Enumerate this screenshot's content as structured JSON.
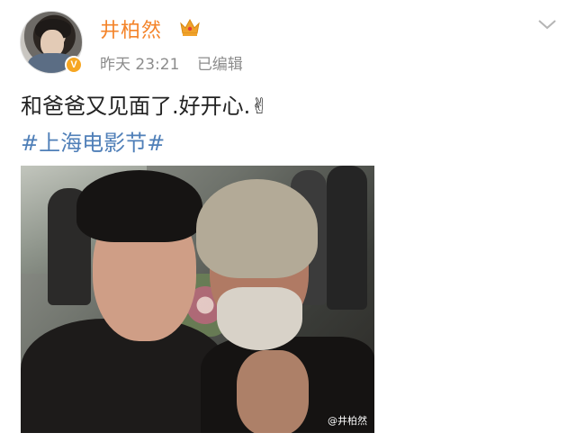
{
  "header": {
    "username": "井柏然",
    "time": "昨天 23:21",
    "edited": "已编辑",
    "verified_badge": "V",
    "crown_icon": "crown-icon",
    "menu_icon": "chevron-down-icon",
    "username_color": "#f4842a"
  },
  "post": {
    "text": "和爸爸又见面了.好开心.✌",
    "hashtag": "#上海电影节#",
    "hashtag_color": "#4f7fb8"
  },
  "photo": {
    "watermark": "@井柏然"
  }
}
